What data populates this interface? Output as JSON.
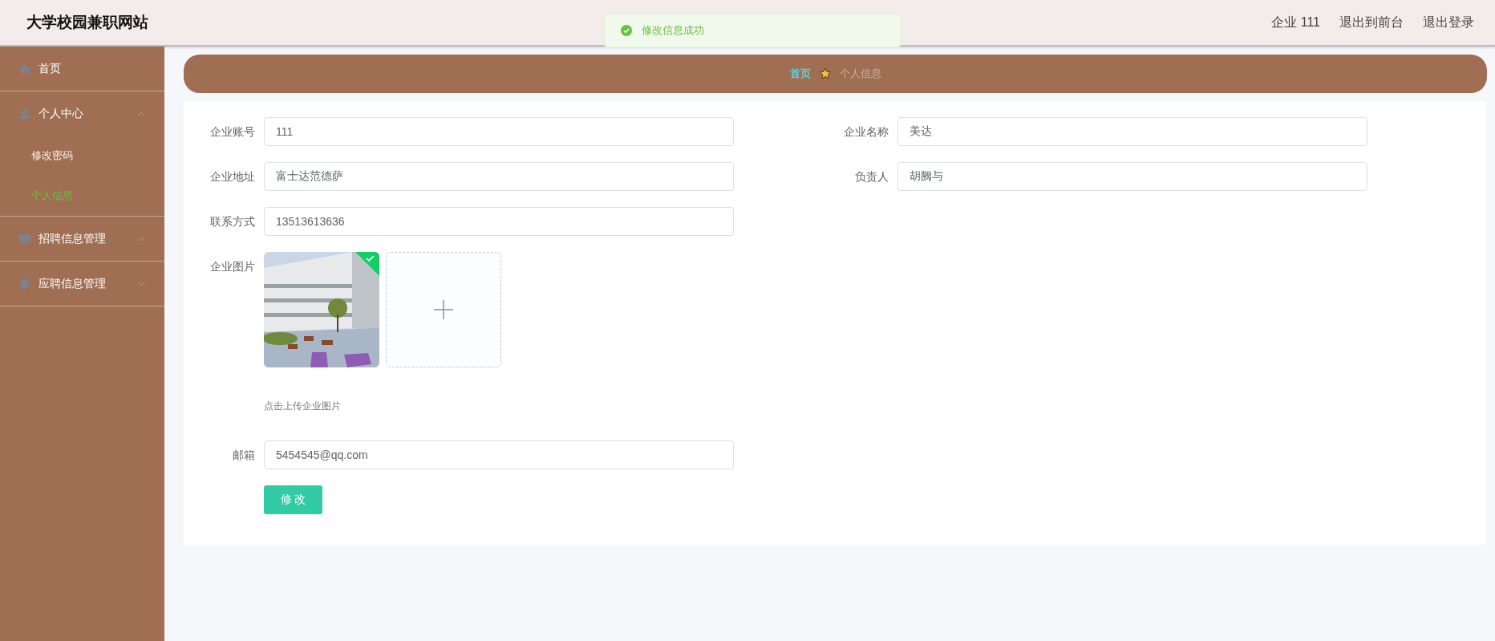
{
  "header": {
    "title": "大学校园兼职网站",
    "user": "企业 111",
    "links": [
      "退出到前台",
      "退出登录"
    ]
  },
  "toast": {
    "kind": "success",
    "message": "修改信息成功"
  },
  "sidebar": {
    "items": [
      {
        "label": "首页",
        "kind": "link"
      },
      {
        "label": "个人中心",
        "kind": "submenu",
        "expanded": true,
        "children": [
          {
            "label": "修改密码",
            "selected": false
          },
          {
            "label": "个人信息",
            "selected": true
          }
        ]
      },
      {
        "label": "招聘信息管理",
        "kind": "submenu",
        "expanded": false
      },
      {
        "label": "应聘信息管理",
        "kind": "submenu",
        "expanded": false
      }
    ]
  },
  "breadcrumb": [
    "首页",
    "个人信息"
  ],
  "form": {
    "rows": [
      [
        {
          "kind": "text",
          "label": "企业账号",
          "value": "111"
        },
        {
          "kind": "text",
          "label": "企业名称",
          "value": "美达"
        }
      ],
      [
        {
          "kind": "text",
          "label": "企业地址",
          "value": "富士达范德萨"
        },
        {
          "kind": "text",
          "label": "负责人",
          "value": "胡阙与"
        }
      ],
      [
        {
          "kind": "text",
          "label": "联系方式",
          "value": "13513613636"
        }
      ],
      [
        {
          "kind": "upload",
          "label": "企业图片",
          "uploaded": true,
          "hint": "点击上传企业图片"
        }
      ],
      [
        {
          "kind": "text",
          "label": "邮箱",
          "value": "5454545@qq.com"
        }
      ]
    ],
    "submit": "修 改"
  }
}
